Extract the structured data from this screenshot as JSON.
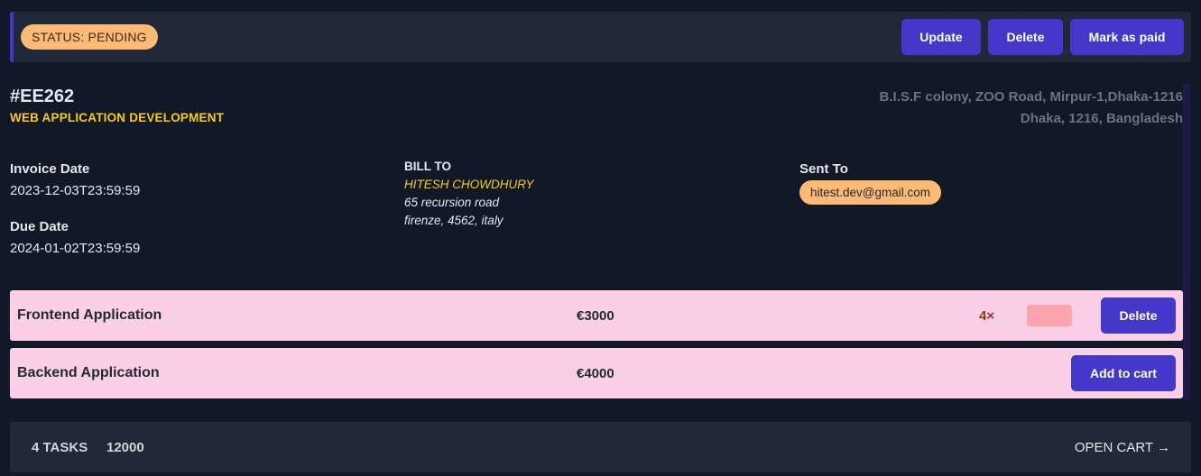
{
  "header": {
    "status": "STATUS: PENDING",
    "update_label": "Update",
    "delete_label": "Delete",
    "mark_paid_label": "Mark as paid"
  },
  "invoice": {
    "id": "#EE262",
    "title": "WEB APPLICATION DEVELOPMENT",
    "address_line1": "B.I.S.F colony, ZOO Road, Mirpur-1,Dhaka-1216",
    "address_line2": "Dhaka, 1216, Bangladesh",
    "invoice_date_label": "Invoice Date",
    "invoice_date": "2023-12-03T23:59:59",
    "due_date_label": "Due Date",
    "due_date": "2024-01-02T23:59:59",
    "bill_to_label": "BILL TO",
    "bill_to_name": "HITESH CHOWDHURY",
    "bill_to_line1": "65 recursion road",
    "bill_to_line2": "firenze, 4562, italy",
    "sent_to_label": "Sent To",
    "sent_to_email": "hitest.dev@gmail.com"
  },
  "items": [
    {
      "name": "Frontend Application",
      "price": "€3000",
      "qty": "4×",
      "action": "Delete"
    },
    {
      "name": "Backend Application",
      "price": "€4000",
      "action": "Add to cart"
    }
  ],
  "footer": {
    "tasks": "4 TASKS",
    "total": "12000",
    "open_cart": "OPEN CART →"
  },
  "colors": {
    "background": "#111827",
    "panel": "#1f2937",
    "accent": "#4338ca",
    "status_badge": "#fdba74",
    "item_row": "#fbcfe8",
    "highlight_text": "#facc15"
  }
}
